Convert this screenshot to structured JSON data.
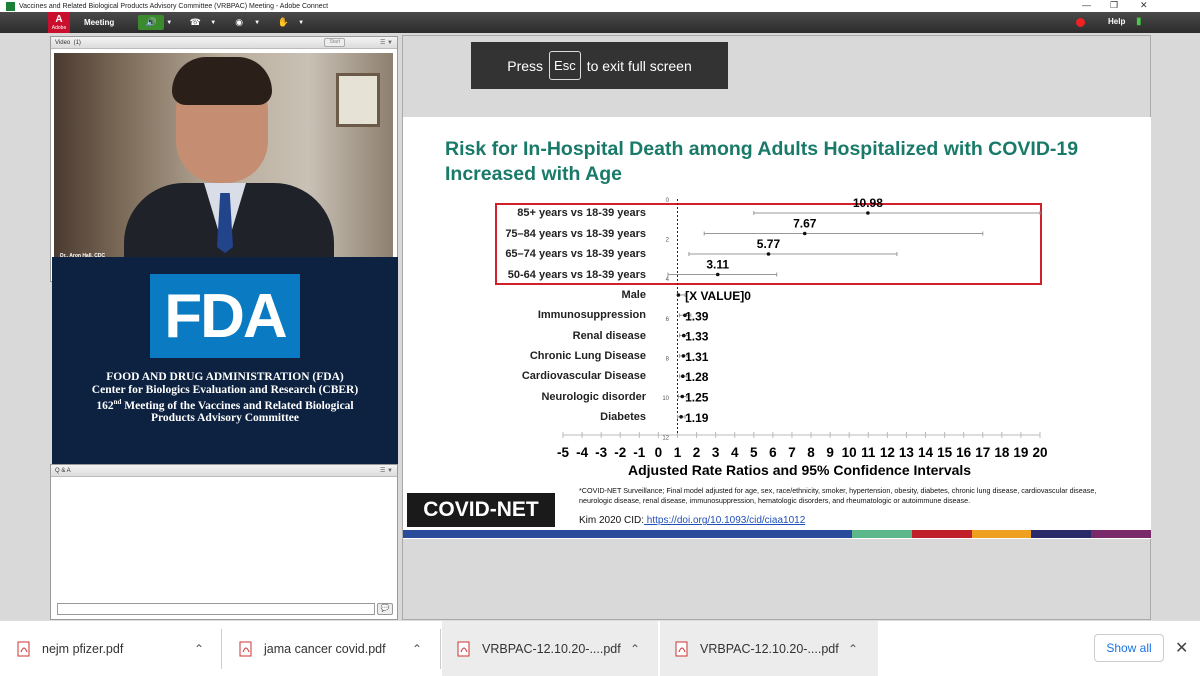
{
  "window": {
    "title": "Vaccines and Related Biological Products Advisory Committee (VRBPAC) Meeting - Adobe Connect"
  },
  "menubar": {
    "adobe_label": "Adobe",
    "meeting_label": "Meeting",
    "help_label": "Help"
  },
  "video_pod": {
    "title": "Video",
    "count": "(1)",
    "start_label": "Start",
    "caption": "Dr.. Aron Hall, CDC"
  },
  "fda_pod": {
    "logo_text": "FDA",
    "line1": "FOOD AND DRUG ADMINISTRATION (FDA)",
    "line2": "Center for Biologics Evaluation and Research (CBER)",
    "line3_num": "162",
    "line3_sup": "nd",
    "line3_rest": " Meeting of the Vaccines and Related Biological",
    "line4": "Products Advisory Committee"
  },
  "qa_pod": {
    "title": "Q & A"
  },
  "escape_banner": {
    "prefix": "Press",
    "key": "Esc",
    "suffix": "to exit full screen"
  },
  "slide": {
    "title_line1": "Risk for In-Hospital Death among Adults Hospitalized with COVID-19",
    "title_line2": "Increased with Age",
    "footnote": "*COVID-NET Surveillance; Final model adjusted for age, sex, race/ethnicity, smoker, hypertension, obesity, diabetes, chronic lung disease, cardiovascular disease, neurologic disease, renal disease, immunosuppression, hematologic disorders, and rheumatologic or autoimmune disease.",
    "citation_prefix": "Kim 2020 CID:",
    "citation_link": " https://doi.org/10.1093/cid/ciaa1012",
    "logo_text": "COVID-NET"
  },
  "chart_data": {
    "type": "scatter",
    "xlabel": "Adjusted Rate Ratios and 95% Confidence Intervals",
    "xlim": [
      -5,
      20
    ],
    "xticks": [
      "-5",
      "-4",
      "-3",
      "-2",
      "-1",
      "0",
      "1",
      "2",
      "3",
      "4",
      "5",
      "6",
      "7",
      "8",
      "9",
      "10",
      "11",
      "12",
      "13",
      "14",
      "15",
      "16",
      "17",
      "18",
      "19",
      "20"
    ],
    "ytick_labels": [
      "0",
      "2",
      "4",
      "6",
      "8",
      "10",
      "12"
    ],
    "reference_line": 1,
    "categories": [
      "85+ years vs 18-39 years",
      "75–84 years vs 18-39 years",
      "65–74 years vs 18-39 years",
      "50-64 years vs 18-39 years",
      "Male",
      "Immunosuppression",
      "Renal disease",
      "Chronic Lung Disease",
      "Cardiovascular Disease",
      "Neurologic disorder",
      "Diabetes"
    ],
    "values": [
      10.98,
      7.67,
      5.77,
      3.11,
      null,
      1.39,
      1.33,
      1.31,
      1.28,
      1.25,
      1.19
    ],
    "value_labels": [
      "10.98",
      "7.67",
      "5.77",
      "3.11",
      "[X VALUE]0",
      "1.39",
      "1.33",
      "1.31",
      "1.28",
      "1.25",
      "1.19"
    ],
    "ci_low": [
      5.0,
      2.4,
      1.6,
      0.5,
      1.0,
      1.1,
      1.1,
      1.1,
      1.1,
      1.05,
      1.0
    ],
    "ci_high": [
      20.0,
      17.0,
      12.5,
      6.2,
      1.4,
      1.7,
      1.6,
      1.55,
      1.5,
      1.5,
      1.4
    ],
    "highlight_box_color": "#d0202a"
  },
  "colors": {
    "title_teal": "#1a7a6a",
    "footer_bar": [
      "#2a4a9a",
      "#2a4a9a",
      "#5cb88a",
      "#c0202a",
      "#f0a020",
      "#2a2a6a",
      "#7a2a6a"
    ]
  },
  "downloads": {
    "items": [
      {
        "name": "nejm pfizer.pdf"
      },
      {
        "name": "jama cancer covid.pdf"
      },
      {
        "name": "VRBPAC-12.10.20-....pdf"
      },
      {
        "name": "VRBPAC-12.10.20-....pdf"
      }
    ],
    "show_all_label": "Show all"
  }
}
